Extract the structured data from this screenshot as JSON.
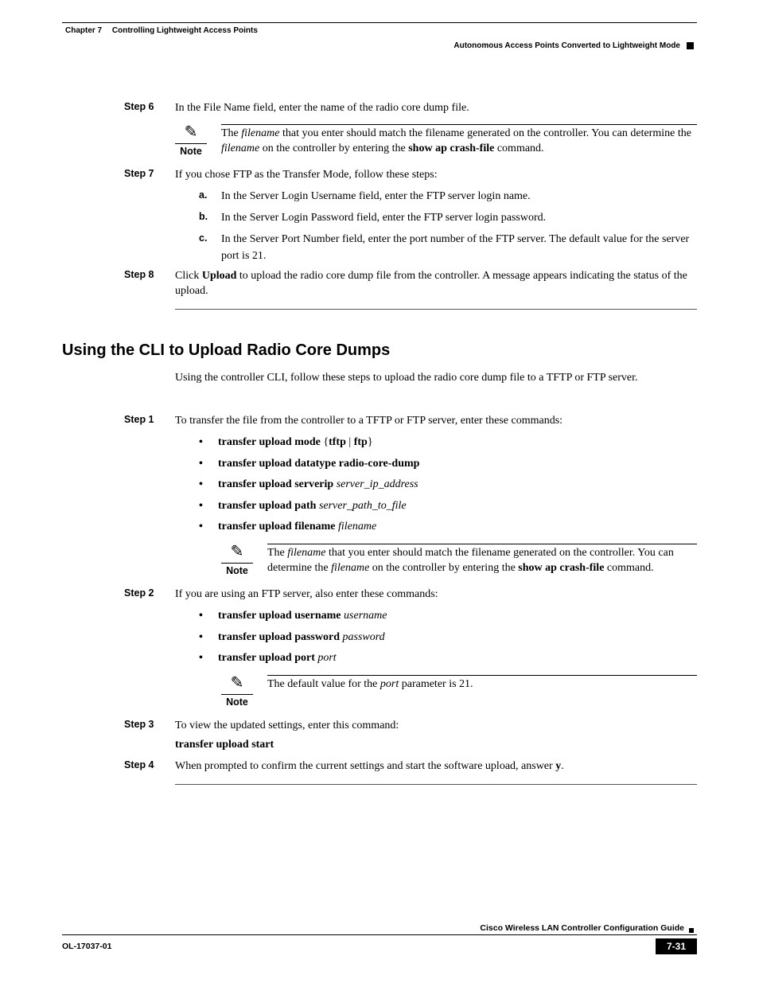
{
  "header": {
    "chapter_label": "Chapter 7",
    "chapter_title": "Controlling Lightweight Access Points",
    "section_breadcrumb": "Autonomous Access Points Converted to Lightweight Mode"
  },
  "stepsA": {
    "s6": {
      "label": "Step 6",
      "text": "In the File Name field, enter the name of the radio core dump file."
    },
    "note6": {
      "label": "Note",
      "pre": "The ",
      "i1": "filename",
      "mid1": " that you enter should match the filename generated on the controller. You can determine the ",
      "i2": "filename",
      "mid2": " on the controller by entering the ",
      "cmd": "show ap crash-file",
      "post": " command."
    },
    "s7": {
      "label": "Step 7",
      "text": "If you chose FTP as the Transfer Mode, follow these steps:"
    },
    "s7a": {
      "m": "a.",
      "text": "In the Server Login Username field, enter the FTP server login name."
    },
    "s7b": {
      "m": "b.",
      "text": "In the Server Login Password field, enter the FTP server login password."
    },
    "s7c": {
      "m": "c.",
      "text": "In the Server Port Number field, enter the port number of the FTP server. The default value for the server port is 21."
    },
    "s8": {
      "label": "Step 8",
      "pre": "Click ",
      "cmd": "Upload",
      "post": " to upload the radio core dump file from the controller. A message appears indicating the status of the upload."
    }
  },
  "sectionB": {
    "title": "Using the CLI to Upload Radio Core Dumps",
    "intro": "Using the controller CLI, follow these steps to upload the radio core dump file to a TFTP or FTP server.",
    "s1": {
      "label": "Step 1",
      "text": "To transfer the file from the controller to a TFTP or FTP server, enter these commands:"
    },
    "b1": {
      "b": "transfer upload mode",
      "rest": " {",
      "o1": "tftp",
      "sep": " | ",
      "o2": "ftp",
      "close": "}"
    },
    "b2": {
      "b": "transfer upload datatype radio-core-dump"
    },
    "b3": {
      "b": "transfer upload serverip ",
      "i": "server_ip_address"
    },
    "b4": {
      "b": "transfer upload path ",
      "i": "server_path_to_file"
    },
    "b5": {
      "b": "transfer upload filename ",
      "i": "filename"
    },
    "note1": {
      "label": "Note",
      "pre": "The ",
      "i1": "filename",
      "mid1": " that you enter should match the filename generated on the controller. You can determine the ",
      "i2": "filename",
      "mid2": " on the controller by entering the ",
      "cmd": "show ap crash-file",
      "post": " command."
    },
    "s2": {
      "label": "Step 2",
      "text": "If you are using an FTP server, also enter these commands:"
    },
    "c1": {
      "b": "transfer upload username ",
      "i": "username"
    },
    "c2": {
      "b": "transfer upload password ",
      "i": "password"
    },
    "c3": {
      "b": "transfer upload port ",
      "i": "port"
    },
    "note2": {
      "label": "Note",
      "pre": "The default value for the ",
      "i": "port",
      "post": " parameter is 21."
    },
    "s3": {
      "label": "Step 3",
      "text": "To view the updated settings, enter this command:"
    },
    "s3cmd": "transfer upload start",
    "s4": {
      "label": "Step 4",
      "pre": "When prompted to confirm the current settings and start the software upload, answer ",
      "ans": "y",
      "post": "."
    }
  },
  "footer": {
    "guide": "Cisco Wireless LAN Controller Configuration Guide",
    "ol": "OL-17037-01",
    "page": "7-31"
  }
}
